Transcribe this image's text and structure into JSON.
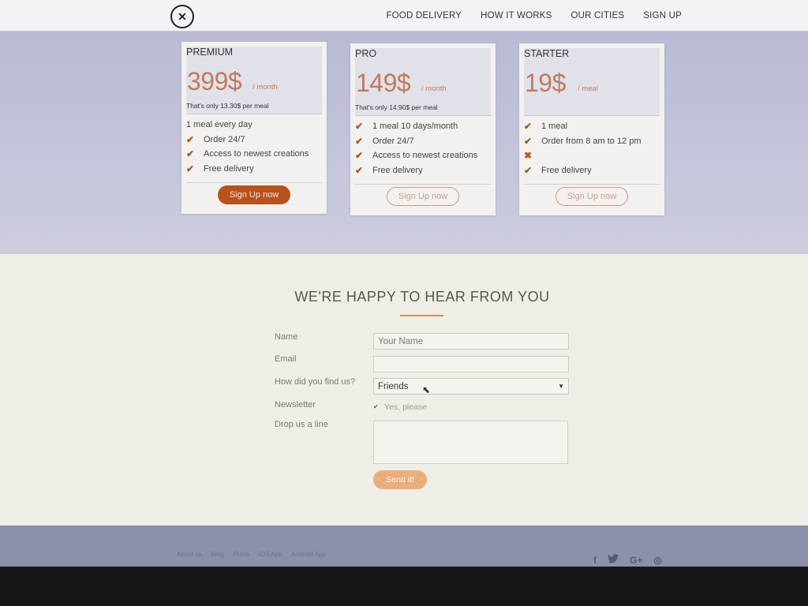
{
  "nav": {
    "logo_glyph": "✕",
    "links": [
      "FOOD DELIVERY",
      "HOW IT WORKS",
      "OUR CITIES",
      "SIGN UP"
    ]
  },
  "plans": [
    {
      "name": "PREMIUM",
      "price": "399$",
      "period": "/ month",
      "note": "That's only 13.30$ per meal",
      "features": [
        {
          "icon": "",
          "text": "1 meal every day"
        },
        {
          "icon": "check-icon",
          "text": "Order 24/7"
        },
        {
          "icon": "check-icon",
          "text": "Access to newest creations"
        },
        {
          "icon": "check-icon",
          "text": "Free delivery"
        }
      ],
      "button": "Sign Up now",
      "button_style": "filled"
    },
    {
      "name": "PRO",
      "price": "149$",
      "period": "/ month",
      "note": "That's only 14.90$ per meal",
      "features": [
        {
          "icon": "check-icon",
          "text": "1 meal 10 days/month"
        },
        {
          "icon": "check-icon",
          "text": "Order 24/7"
        },
        {
          "icon": "check-icon",
          "text": "Access to newest creations"
        },
        {
          "icon": "check-icon",
          "text": "Free delivery"
        }
      ],
      "button": "Sign Up now",
      "button_style": "outline"
    },
    {
      "name": "STARTER",
      "price": "19$",
      "period": "/ meal",
      "note": "",
      "features": [
        {
          "icon": "check-icon",
          "text": "1 meal"
        },
        {
          "icon": "check-icon",
          "text": "Order from 8 am to 12 pm"
        },
        {
          "icon": "cross-icon",
          "text": ""
        },
        {
          "icon": "check-icon",
          "text": "Free delivery"
        }
      ],
      "button": "Sign Up now",
      "button_style": "outline"
    }
  ],
  "contact": {
    "title": "WE'RE HAPPY TO HEAR FROM YOU",
    "labels": {
      "name": "Name",
      "email": "Email",
      "find": "How did you find us?",
      "newsletter": "Newsletter",
      "message": "Drop us a line"
    },
    "name_placeholder": "Your Name",
    "email_value": "",
    "find_selected": "Friends",
    "newsletter_text": "Yes, please",
    "send_label": "Send it!"
  },
  "footer": {
    "links": [
      "About us",
      "Blog",
      "Press",
      "iOS App",
      "Android App"
    ],
    "social": [
      {
        "name": "facebook-icon",
        "glyph": "f"
      },
      {
        "name": "twitter-icon",
        "glyph": "🐦"
      },
      {
        "name": "google-plus-icon",
        "glyph": "G+"
      },
      {
        "name": "instagram-icon",
        "glyph": "◎"
      }
    ]
  },
  "colors": {
    "accent": "#b7521d",
    "price": "#c07b5e",
    "send": "#eaae7e"
  }
}
